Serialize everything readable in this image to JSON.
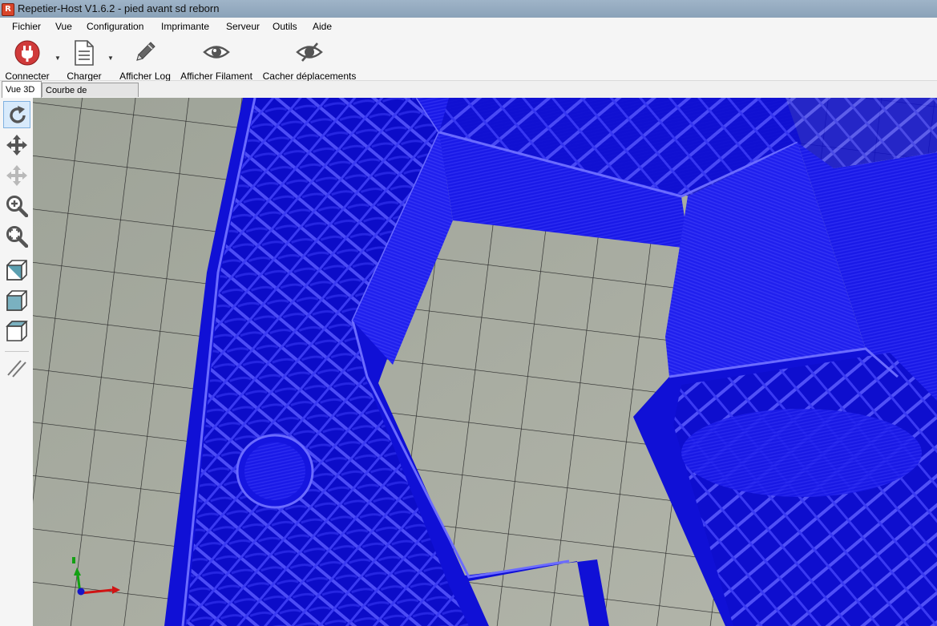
{
  "window": {
    "title": "Repetier-Host V1.6.2 - pied avant sd reborn",
    "app_icon": "R"
  },
  "menu": [
    "Fichier",
    "Vue",
    "Configuration",
    "Imprimante",
    "Serveur",
    "Outils",
    "Aide"
  ],
  "toolbar": {
    "connect": "Connecter",
    "load": "Charger",
    "show_log": "Afficher Log",
    "show_filament": "Afficher Filament",
    "hide_moves": "Cacher  déplacements"
  },
  "tabs": [
    "Vue 3D",
    "Courbe de Température"
  ],
  "sidebar_tools": [
    "rotate-icon",
    "move-icon",
    "move-object-icon",
    "zoom-in-icon",
    "fit-view-icon",
    "isometric-view-icon",
    "front-view-icon",
    "top-view-icon",
    "parallel-projection-icon"
  ],
  "colors": {
    "model": "#1414e6",
    "model_highlight": "#5a5aff",
    "bed": "#a8aca1",
    "grid_line": "#2a2a2a",
    "connect_red": "#d03a3a"
  }
}
